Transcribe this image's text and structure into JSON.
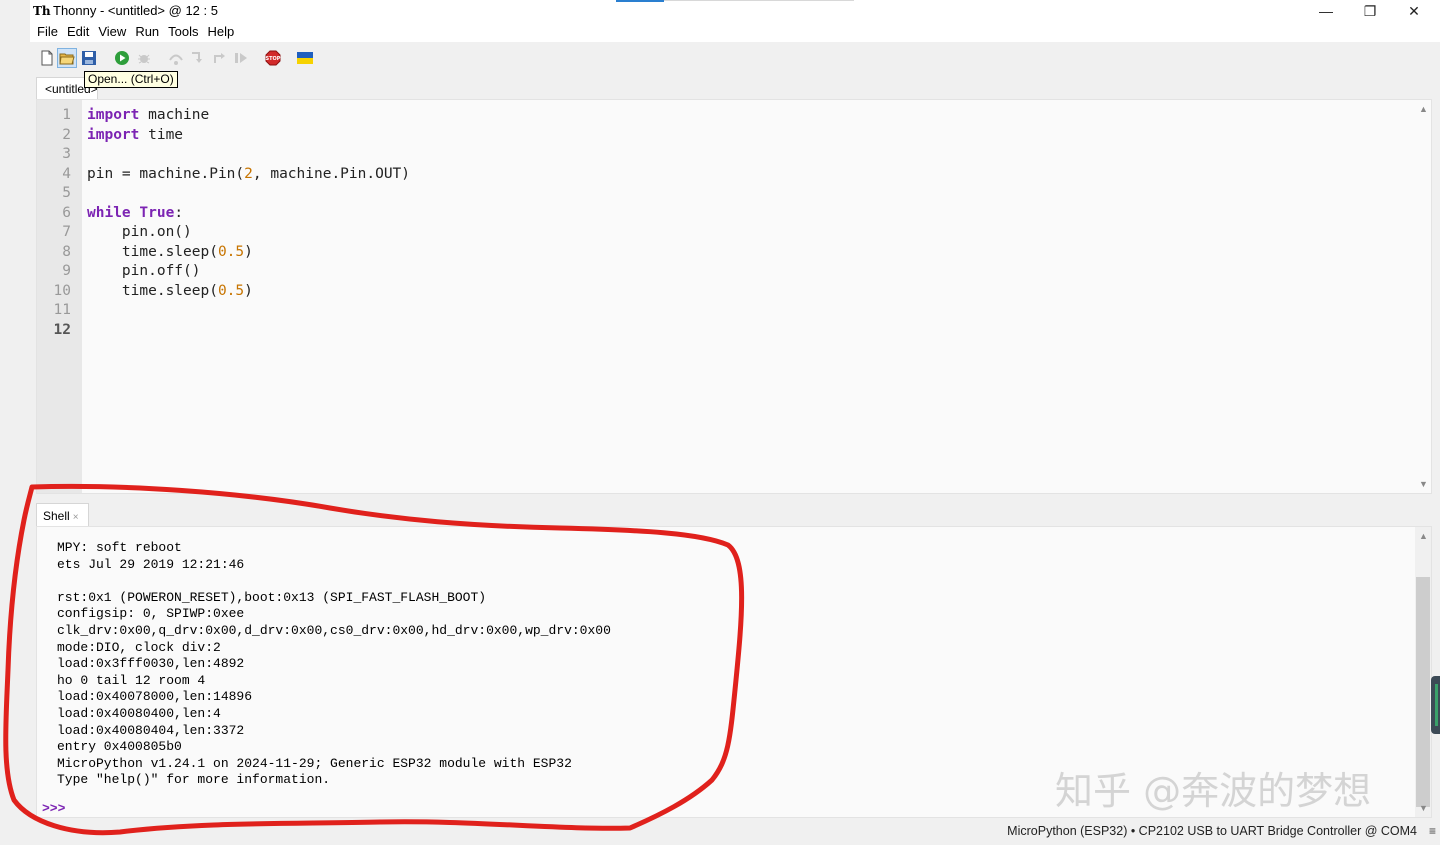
{
  "window": {
    "title": "Thonny  -  <untitled>  @  12 : 5",
    "app_icon_text": "Th",
    "controls": {
      "minimize": "—",
      "maximize": "❐",
      "close": "✕"
    }
  },
  "menu": [
    "File",
    "Edit",
    "View",
    "Run",
    "Tools",
    "Help"
  ],
  "toolbar": {
    "tooltip": "Open... (Ctrl+O)",
    "buttons": [
      "new-file-icon",
      "open-folder-icon",
      "save-icon",
      "run-icon",
      "debug-icon",
      "step-over-icon",
      "step-into-icon",
      "step-out-icon",
      "resume-icon",
      "stop-icon",
      "ukraine-flag-icon"
    ]
  },
  "editor": {
    "tab_label": "<untitled>",
    "line_numbers": [
      "1",
      "2",
      "3",
      "4",
      "5",
      "6",
      "7",
      "8",
      "9",
      "10",
      "11",
      "12"
    ],
    "lines": [
      [
        "import",
        " machine"
      ],
      [
        "import",
        " time"
      ],
      [],
      [
        "pin = machine.Pin(",
        "2",
        ", machine.Pin.OUT)"
      ],
      [],
      [
        "while",
        " ",
        "True",
        ":"
      ],
      [
        "    pin.on()"
      ],
      [
        "    time.sleep(",
        "0.5",
        ")"
      ],
      [
        "    pin.off()"
      ],
      [
        "    time.sleep(",
        "0.5",
        ")"
      ],
      [],
      []
    ]
  },
  "shell": {
    "tab_label": "Shell",
    "tab_close": "×",
    "output": [
      "MPY: soft reboot",
      "ets Jul 29 2019 12:21:46",
      "",
      "rst:0x1 (POWERON_RESET),boot:0x13 (SPI_FAST_FLASH_BOOT)",
      "configsip: 0, SPIWP:0xee",
      "clk_drv:0x00,q_drv:0x00,d_drv:0x00,cs0_drv:0x00,hd_drv:0x00,wp_drv:0x00",
      "mode:DIO, clock div:2",
      "load:0x3fff0030,len:4892",
      "ho 0 tail 12 room 4",
      "load:0x40078000,len:14896",
      "load:0x40080400,len:4",
      "load:0x40080404,len:3372",
      "entry 0x400805b0",
      "MicroPython v1.24.1 on 2024-11-29; Generic ESP32 module with ESP32",
      "Type \"help()\" for more information."
    ],
    "prompt": ">>>"
  },
  "status": {
    "text": "MicroPython (ESP32)  •  CP2102 USB to UART Bridge Controller @ COM4",
    "grip": "≡"
  },
  "watermark": "知乎 @奔波的梦想",
  "colors": {
    "keyword": "#7c24b3",
    "number": "#c77400",
    "annotation": "#e0211c"
  }
}
